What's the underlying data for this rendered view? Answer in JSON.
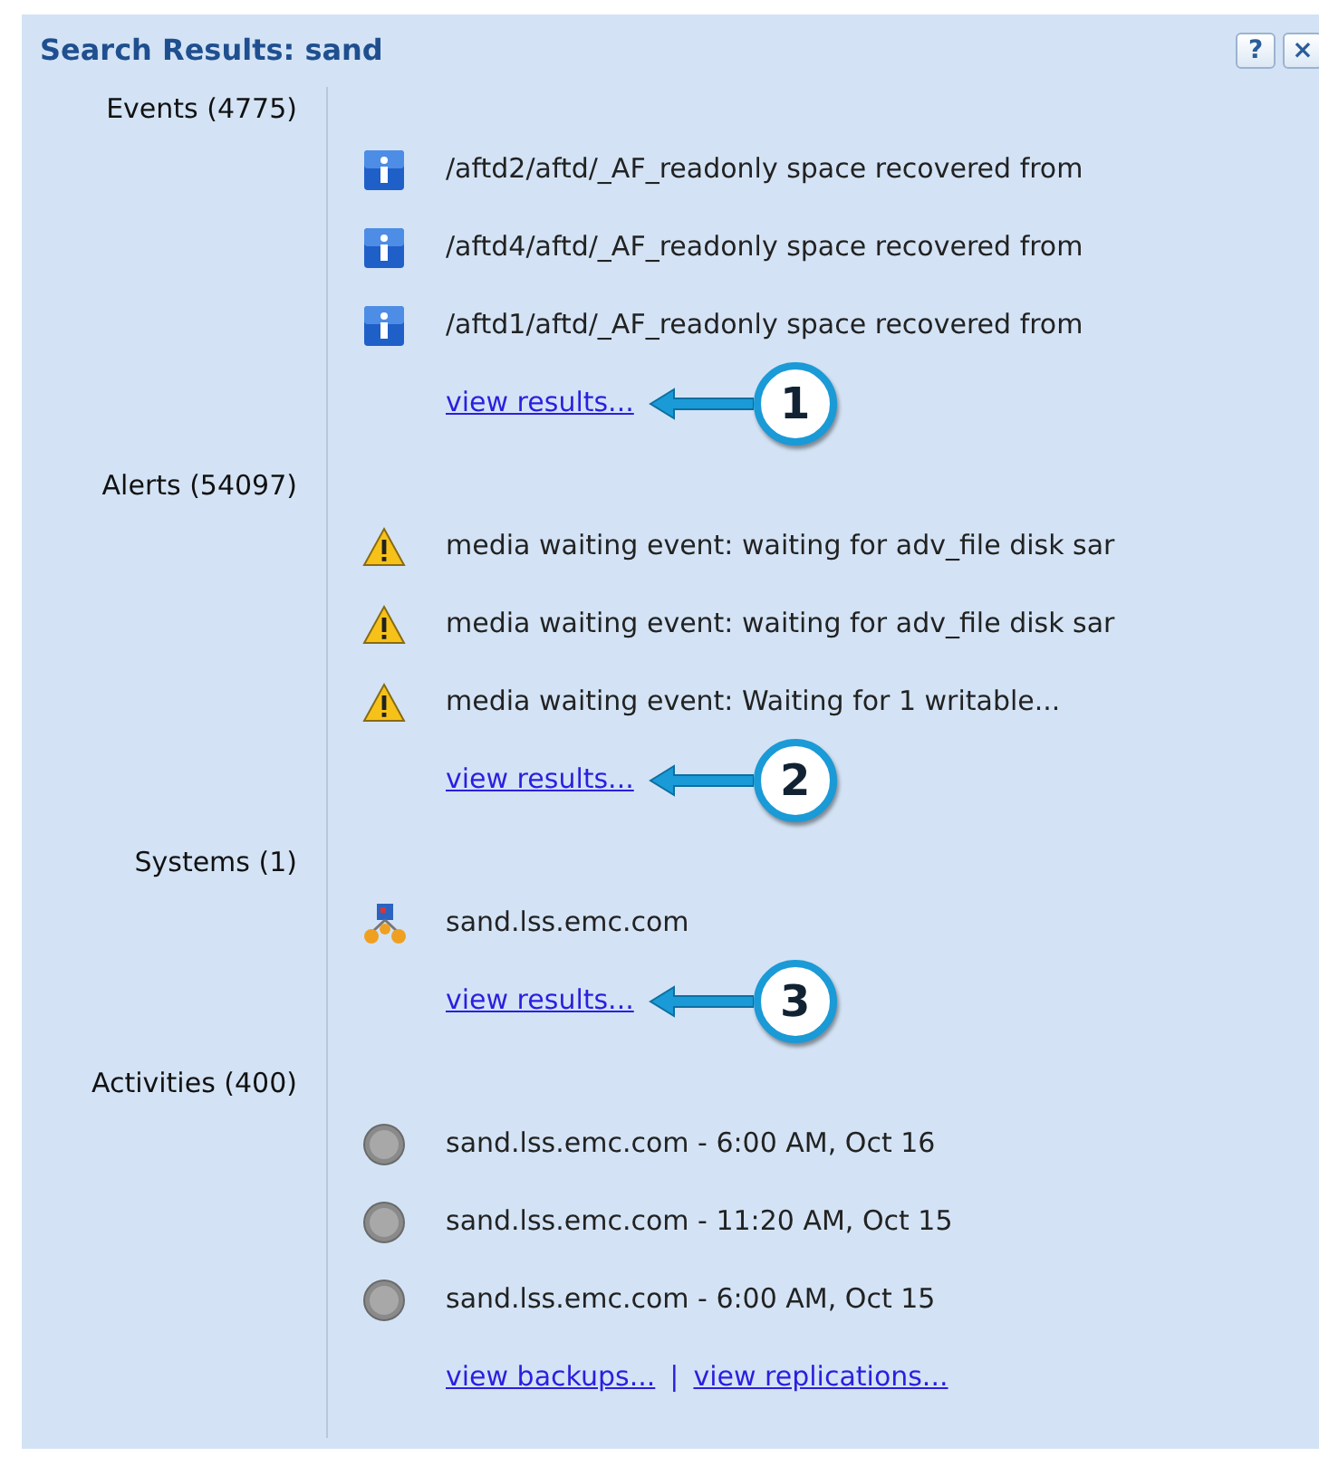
{
  "window": {
    "title": "Search Results: sand",
    "help": "?",
    "close": "×"
  },
  "sections": [
    {
      "label": "Events (4775)",
      "items": [
        {
          "kind": "info",
          "text": "/aftd2/aftd/_AF_readonly space recovered from"
        },
        {
          "kind": "info",
          "text": "/aftd4/aftd/_AF_readonly space recovered from"
        },
        {
          "kind": "info",
          "text": "/aftd1/aftd/_AF_readonly space recovered from"
        }
      ],
      "links": [
        "view results..."
      ],
      "callout": "1"
    },
    {
      "label": "Alerts (54097)",
      "items": [
        {
          "kind": "warning",
          "text": "media waiting event: waiting for adv_file disk sar"
        },
        {
          "kind": "warning",
          "text": "media waiting event: waiting for adv_file disk sar"
        },
        {
          "kind": "warning",
          "text": "media waiting event: Waiting for 1 writable..."
        }
      ],
      "links": [
        "view results..."
      ],
      "callout": "2"
    },
    {
      "label": "Systems (1)",
      "items": [
        {
          "kind": "system",
          "text": "sand.lss.emc.com"
        }
      ],
      "links": [
        "view results..."
      ],
      "callout": "3"
    },
    {
      "label": "Activities (400)",
      "items": [
        {
          "kind": "activity",
          "text": "sand.lss.emc.com - 6:00 AM, Oct 16"
        },
        {
          "kind": "activity",
          "text": "sand.lss.emc.com - 11:20 AM, Oct 15"
        },
        {
          "kind": "activity",
          "text": "sand.lss.emc.com - 6:00 AM, Oct 15"
        }
      ],
      "links": [
        "view backups...",
        "view replications..."
      ],
      "separator": "|"
    }
  ]
}
